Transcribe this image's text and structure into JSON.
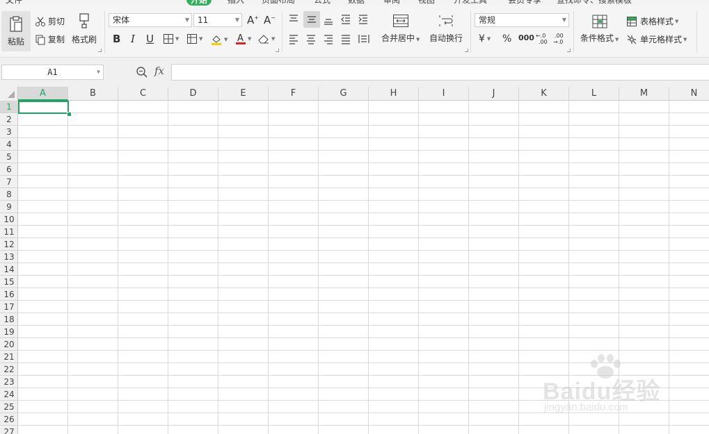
{
  "menubar": {
    "items": [
      "文件",
      "开始",
      "插入",
      "页面布局",
      "公式",
      "数据",
      "审阅",
      "视图",
      "开发工具",
      "会员专享",
      "查找命令、搜索模板"
    ],
    "active_index": 1
  },
  "ribbon": {
    "paste_label": "粘贴",
    "cut_label": "剪切",
    "copy_label": "复制",
    "format_painter_label": "格式刷",
    "font_name": "宋体",
    "font_size": "11",
    "merge_center_label": "合并居中",
    "wrap_text_label": "自动换行",
    "number_format": "常规",
    "conditional_format_label": "条件格式",
    "table_style_label": "表格样式",
    "cell_style_label": "单元格样式",
    "currency_symbol": "¥",
    "percent_symbol": "%",
    "thousands_symbol": "000"
  },
  "formula_bar": {
    "cell_ref": "A1",
    "fx_label": "fx",
    "formula": ""
  },
  "sheet": {
    "columns": [
      "A",
      "B",
      "C",
      "D",
      "E",
      "F",
      "G",
      "H",
      "I",
      "J",
      "K",
      "L",
      "M",
      "N"
    ],
    "rows": [
      "1",
      "2",
      "3",
      "4",
      "5",
      "6",
      "7",
      "8",
      "9",
      "10",
      "11",
      "12",
      "13",
      "14",
      "15",
      "16",
      "17",
      "18",
      "19",
      "20",
      "21",
      "22",
      "23",
      "24",
      "25",
      "26",
      "27"
    ],
    "selected_cell": "A1"
  },
  "watermark": {
    "brand": "Baidu经验",
    "url": "jingyan.baidu.com"
  },
  "colors": {
    "accent": "#21a366",
    "menu_active": "#2fb25a",
    "ribbon_bg": "#f5f5f5",
    "font_color_bar": "#e02020",
    "fill_color_bar": "#f5d000"
  }
}
